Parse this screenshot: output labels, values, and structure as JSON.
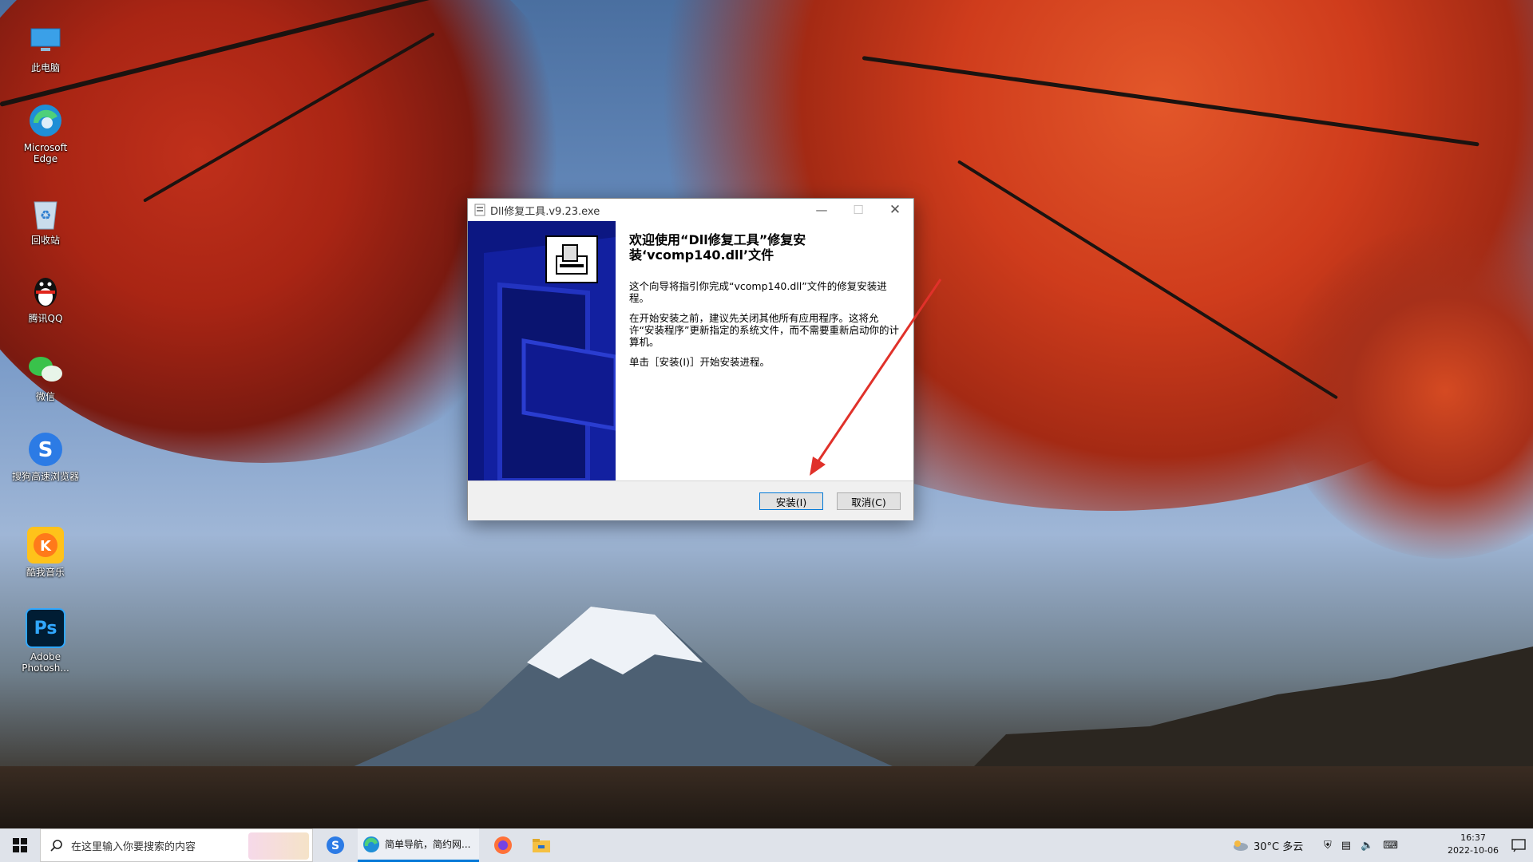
{
  "desktop": {
    "icons": [
      {
        "label": "此电脑",
        "icon": "computer-icon"
      },
      {
        "label": "Microsoft Edge",
        "icon": "edge-icon"
      },
      {
        "label": "回收站",
        "icon": "recycle-bin-icon"
      },
      {
        "label": "腾讯QQ",
        "icon": "qq-icon"
      },
      {
        "label": "微信",
        "icon": "wechat-icon"
      },
      {
        "label": "搜狗高速浏览器",
        "icon": "sogou-browser-icon"
      },
      {
        "label": "酷我音乐",
        "icon": "kuwo-music-icon"
      },
      {
        "label": "Adobe Photosh...",
        "icon": "photoshop-icon"
      }
    ]
  },
  "dialog": {
    "title": "Dll修复工具.v9.23.exe",
    "heading": "欢迎使用“Dll修复工具”修复安装‘vcomp140.dll’文件",
    "para1": "这个向导将指引你完成“vcomp140.dll”文件的修复安装进程。",
    "para2": "在开始安装之前，建议先关闭其他所有应用程序。这将允许“安装程序”更新指定的系统文件，而不需要重新启动你的计算机。",
    "para3": "单击［安装(I)］开始安装进程。",
    "install_label": "安装(I)",
    "cancel_label": "取消(C)"
  },
  "taskbar": {
    "search_placeholder": "在这里输入你要搜索的内容",
    "edge_window_label": "简单导航，简约网...",
    "weather": "30°C 多云",
    "time": "16:37",
    "date": "2022-10-06"
  },
  "colors": {
    "banner": "#0c1782",
    "accent": "#0078d7",
    "arrow": "#e0312a"
  }
}
